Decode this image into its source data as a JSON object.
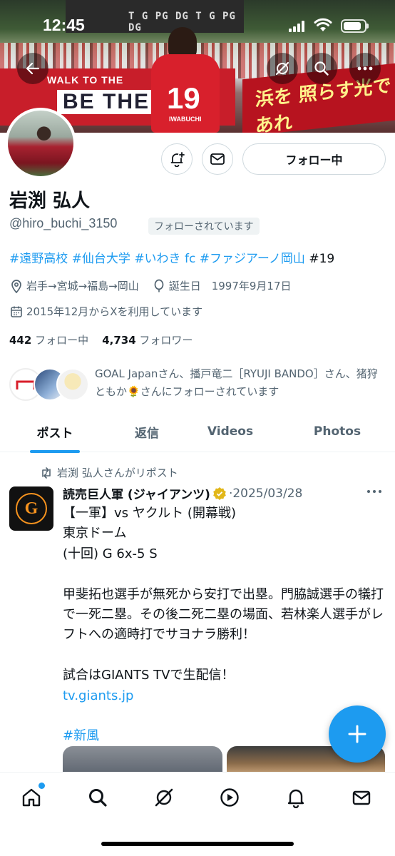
{
  "status": {
    "time": "12:45"
  },
  "banner": {
    "sign_small": "WALK TO THE",
    "sign_big": "BE THE L",
    "sign_jp": "浜を 照らす光であれ",
    "scoreboard": "T G PG DG  T G PG DG",
    "jersey_number": "19",
    "jersey_name": "IWABUCHI"
  },
  "profile": {
    "name": "岩渕 弘人",
    "handle": "@hiro_buchi_3150",
    "follows_you": "フォローされています",
    "bio_tags": [
      "#遠野高校",
      "#仙台大学",
      "#いわき fc",
      "#ファジアーノ岡山"
    ],
    "bio_tail": "#19",
    "location": "岩手→宮城→福島→岡山",
    "birthday": "誕生日　1997年9月17日",
    "joined": "2015年12月からXを利用しています",
    "following_count": "442",
    "following_label": "フォロー中",
    "followers_count": "4,734",
    "followers_label": "フォロワー",
    "mutuals_text": "GOAL Japanさん、播戸竜二［RYUJI BANDO］さん、猪狩ともか🌻さんにフォローされています"
  },
  "actions": {
    "follow_label": "フォロー中"
  },
  "tabs": [
    {
      "label": "ポスト"
    },
    {
      "label": "返信"
    },
    {
      "label": "Videos"
    },
    {
      "label": "Photos"
    }
  ],
  "post": {
    "repost_label": "岩渕 弘人さんがリポスト",
    "author": "読売巨人軍 (ジャイアンツ)",
    "date": "·2025/03/28",
    "avatar_letter": "G",
    "body": "【一軍】vs ヤクルト (開幕戦)\n東京ドーム\n(十回) G 6x-5 S\n\n甲斐拓也選手が無死から安打で出塁。門脇誠選手の犠打で一死二塁。その後二死二塁の場面、若林楽人選手がレフトへの適時打でサヨナラ勝利！\n\n試合はGIANTS TVで生配信！",
    "link": "tv.giants.jp",
    "hashtag": "#新風"
  },
  "colors": {
    "accent": "#1d9bf0",
    "secondary_text": "#536471",
    "giants_orange": "#f7931e"
  }
}
